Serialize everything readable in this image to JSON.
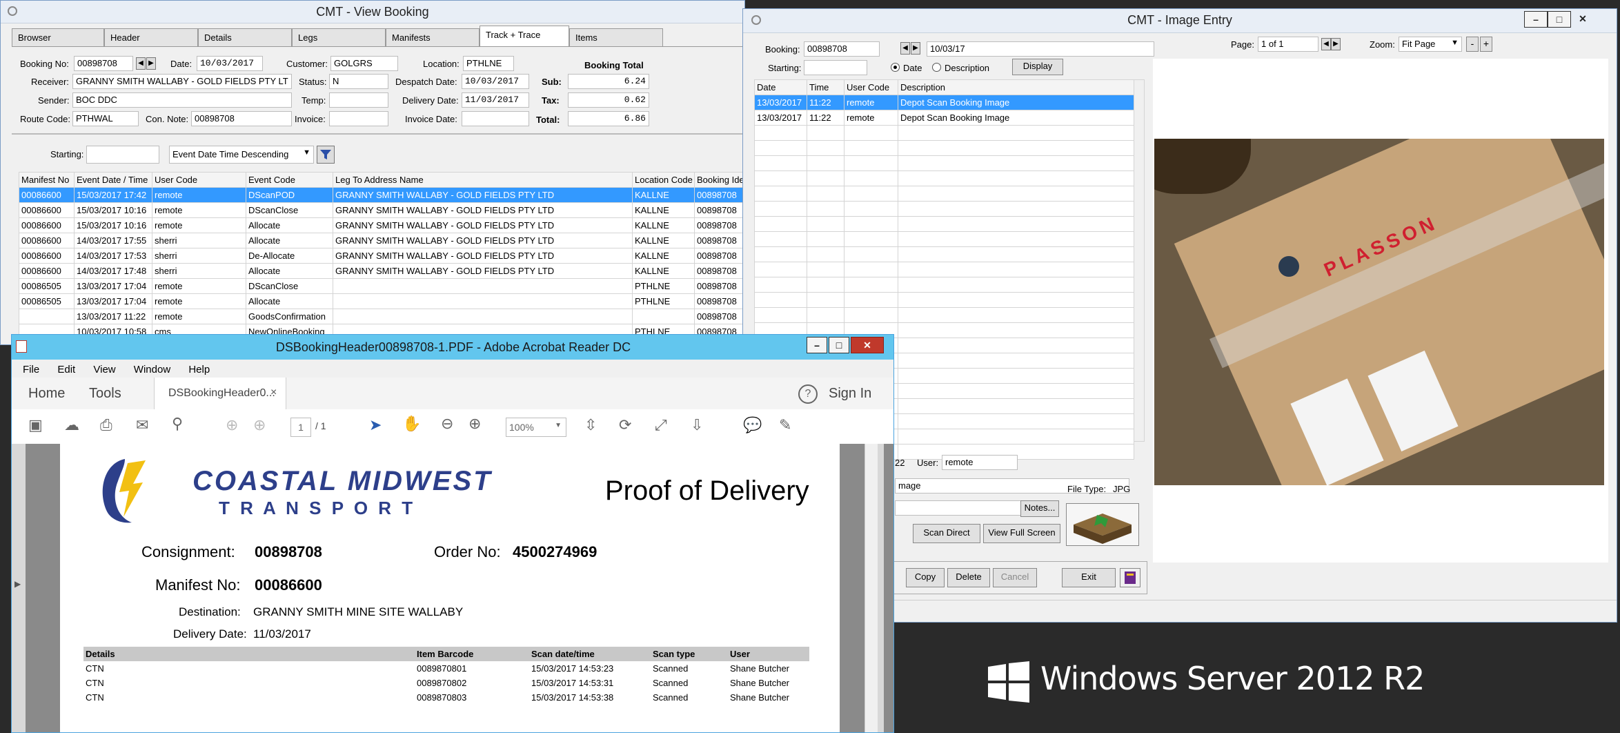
{
  "desktop": {
    "os_branding": "Windows Server 2012 R2"
  },
  "view_booking": {
    "title": "CMT - View Booking",
    "tabs": [
      "Browser",
      "Header",
      "Details",
      "Legs",
      "Manifests",
      "Track + Trace",
      "Items"
    ],
    "active_tab": "Track + Trace",
    "fields": {
      "booking_no_label": "Booking No:",
      "booking_no": "00898708",
      "date_label": "Date:",
      "date": "10/03/2017",
      "customer_label": "Customer:",
      "customer": "GOLGRS",
      "location_label": "Location:",
      "location": "PTHLNE",
      "receiver_label": "Receiver:",
      "receiver": "GRANNY SMITH WALLABY - GOLD FIELDS PTY LT",
      "status_label": "Status:",
      "status": "N",
      "despatch_date_label": "Despatch Date:",
      "despatch_date": "10/03/2017",
      "sender_label": "Sender:",
      "sender": "BOC DDC",
      "temp_label": "Temp:",
      "temp": "",
      "delivery_date_label": "Delivery Date:",
      "delivery_date": "11/03/2017",
      "route_code_label": "Route Code:",
      "route_code": "PTHWAL",
      "con_note_label": "Con. Note:",
      "con_note": "00898708",
      "invoice_label": "Invoice:",
      "invoice": "",
      "invoice_date_label": "Invoice Date:",
      "invoice_date": ""
    },
    "totals": {
      "title": "Booking Total",
      "sub_label": "Sub:",
      "sub": "6.24",
      "tax_label": "Tax:",
      "tax": "0.62",
      "total_label": "Total:",
      "total": "6.86"
    },
    "filter": {
      "starting_label": "Starting:",
      "starting_value": "",
      "sort": "Event Date Time Descending"
    },
    "columns": [
      "Manifest No",
      "Event Date / Time",
      "User Code",
      "Event Code",
      "Leg To Address Name",
      "Location Code",
      "Booking Ide"
    ],
    "rows": [
      [
        "00086600",
        "15/03/2017 17:42",
        "remote",
        "DScanPOD",
        "GRANNY SMITH WALLABY - GOLD FIELDS PTY LTD",
        "KALLNE",
        "00898708"
      ],
      [
        "00086600",
        "15/03/2017 10:16",
        "remote",
        "DScanClose",
        "GRANNY SMITH WALLABY - GOLD FIELDS PTY LTD",
        "KALLNE",
        "00898708"
      ],
      [
        "00086600",
        "15/03/2017 10:16",
        "remote",
        "Allocate",
        "GRANNY SMITH WALLABY - GOLD FIELDS PTY LTD",
        "KALLNE",
        "00898708"
      ],
      [
        "00086600",
        "14/03/2017 17:55",
        "sherri",
        "Allocate",
        "GRANNY SMITH WALLABY - GOLD FIELDS PTY LTD",
        "KALLNE",
        "00898708"
      ],
      [
        "00086600",
        "14/03/2017 17:53",
        "sherri",
        "De-Allocate",
        "GRANNY SMITH WALLABY - GOLD FIELDS PTY LTD",
        "KALLNE",
        "00898708"
      ],
      [
        "00086600",
        "14/03/2017 17:48",
        "sherri",
        "Allocate",
        "GRANNY SMITH WALLABY - GOLD FIELDS PTY LTD",
        "KALLNE",
        "00898708"
      ],
      [
        "00086505",
        "13/03/2017 17:04",
        "remote",
        "DScanClose",
        "",
        "PTHLNE",
        "00898708"
      ],
      [
        "00086505",
        "13/03/2017 17:04",
        "remote",
        "Allocate",
        "",
        "PTHLNE",
        "00898708"
      ],
      [
        "",
        "13/03/2017 11:22",
        "remote",
        "GoodsConfirmation",
        "",
        "",
        "00898708"
      ],
      [
        "",
        "10/03/2017 10:58",
        "cms",
        "NewOnlineBooking",
        "",
        "PTHLNE",
        "00898708"
      ]
    ]
  },
  "image_entry": {
    "title": "CMT - Image Entry",
    "booking_label": "Booking:",
    "booking": "00898708",
    "date": "10/03/17",
    "page_label": "Page:",
    "page": "1 of 1",
    "zoom_label": "Zoom:",
    "zoom": "Fit Page",
    "starting_label": "Starting:",
    "radio_date": "Date",
    "radio_description": "Description",
    "display_button": "Display",
    "columns": [
      "Date",
      "Time",
      "User Code",
      "Description"
    ],
    "rows": [
      [
        "13/03/2017",
        "11:22",
        "remote",
        "Depot Scan Booking Image"
      ],
      [
        "13/03/2017",
        "11:22",
        "remote",
        "Depot Scan Booking Image"
      ]
    ],
    "partial_time": "22",
    "user_label": "User:",
    "user": "remote",
    "partial_desc": "mage",
    "file_type_label": "File Type:",
    "file_type": "JPG",
    "notes_button": "Notes...",
    "scan_direct_button": "Scan Direct",
    "view_full_button": "View Full Screen",
    "copy_button": "Copy",
    "delete_button": "Delete",
    "cancel_button": "Cancel",
    "exit_button": "Exit",
    "tape_text": "PLASSON"
  },
  "acrobat": {
    "title": "DSBookingHeader00898708-1.PDF - Adobe Acrobat Reader DC",
    "menu": [
      "File",
      "Edit",
      "View",
      "Window",
      "Help"
    ],
    "home_tab": "Home",
    "tools_tab": "Tools",
    "doc_tab": "DSBookingHeader0...",
    "help_icon_text": "?",
    "sign_in": "Sign In",
    "page_current": "1",
    "page_total": "/ 1",
    "zoom": "100%"
  },
  "pod": {
    "company_line1": "COASTAL MIDWEST",
    "company_line2": "T R A N S P O R T",
    "heading": "Proof of Delivery",
    "consignment_label": "Consignment:",
    "consignment": "00898708",
    "order_no_label": "Order No:",
    "order_no": "4500274969",
    "manifest_label": "Manifest No:",
    "manifest": "00086600",
    "destination_label": "Destination:",
    "destination": "GRANNY SMITH MINE SITE WALLABY",
    "delivery_date_label": "Delivery Date:",
    "delivery_date": "11/03/2017",
    "columns": [
      "Details",
      "Item Barcode",
      "Scan date/time",
      "Scan type",
      "User"
    ],
    "rows": [
      [
        "CTN",
        "0089870801",
        "15/03/2017 14:53:23",
        "Scanned",
        "Shane Butcher"
      ],
      [
        "CTN",
        "0089870802",
        "15/03/2017 14:53:31",
        "Scanned",
        "Shane Butcher"
      ],
      [
        "CTN",
        "0089870803",
        "15/03/2017 14:53:38",
        "Scanned",
        "Shane Butcher"
      ]
    ]
  }
}
